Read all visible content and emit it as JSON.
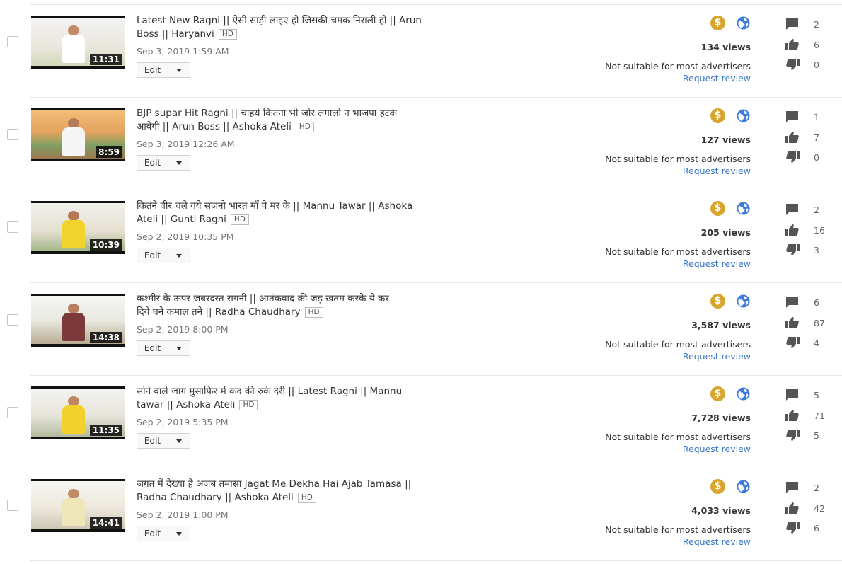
{
  "edit_label": "Edit",
  "hd_label": "HD",
  "colors": {
    "accent_link": "#3a78c3",
    "monetization": "#d8a52f",
    "globe": "#3d7be0"
  },
  "videos": [
    {
      "title_line1": "Latest New Ragni || ऐसी साड़ी लाइए हो जिसकी चमक निराली हो || Arun",
      "title_line2": "Boss || Haryanvi",
      "duration": "11:31",
      "date": "Sep 3, 2019 1:59 AM",
      "views": "134 views",
      "ad_status": "Not suitable for most advertisers",
      "review_link": "Request review",
      "comments": "2",
      "likes": "6",
      "dislikes": "0"
    },
    {
      "title_line1": "BJP supar Hit Ragni || चाहये कितना भी जोर लगालो न भाजपा हटके",
      "title_line2": "आवेगी || Arun Boss || Ashoka Ateli",
      "duration": "8:59",
      "date": "Sep 3, 2019 12:26 AM",
      "views": "127 views",
      "ad_status": "Not suitable for most advertisers",
      "review_link": "Request review",
      "comments": "1",
      "likes": "7",
      "dislikes": "0"
    },
    {
      "title_line1": "कितने वीर चले गये सजनो भारत माँ पे मर के || Mannu Tawar || Ashoka",
      "title_line2": "Ateli || Gunti Ragni",
      "duration": "10:39",
      "date": "Sep 2, 2019 10:35 PM",
      "views": "205 views",
      "ad_status": "Not suitable for most advertisers",
      "review_link": "Request review",
      "comments": "2",
      "likes": "16",
      "dislikes": "3"
    },
    {
      "title_line1": "कश्मीर के ऊपर जबरदस्त रागनी || आतंकवाद की जड़ ख़तम करके ये कर",
      "title_line2": "दिये घने कमाल तने || Radha Chaudhary",
      "duration": "14:38",
      "date": "Sep 2, 2019 8:00 PM",
      "views": "3,587 views",
      "ad_status": "Not suitable for most advertisers",
      "review_link": "Request review",
      "comments": "6",
      "likes": "87",
      "dislikes": "4"
    },
    {
      "title_line1": "सोने वाले जाग मुसाफिर में कद की रुके देरी || Latest Ragni || Mannu",
      "title_line2": "tawar || Ashoka Ateli",
      "duration": "11:35",
      "date": "Sep 2, 2019 5:35 PM",
      "views": "7,728 views",
      "ad_status": "Not suitable for most advertisers",
      "review_link": "Request review",
      "comments": "5",
      "likes": "71",
      "dislikes": "5"
    },
    {
      "title_line1": "जगत में देख्या है अजब तमासा Jagat Me Dekha Hai Ajab Tamasa ||",
      "title_line2": "Radha Chaudhary || Ashoka Ateli",
      "duration": "14:41",
      "date": "Sep 2, 2019 1:00 PM",
      "views": "4,033 views",
      "ad_status": "Not suitable for most advertisers",
      "review_link": "Request review",
      "comments": "2",
      "likes": "42",
      "dislikes": "6"
    }
  ]
}
